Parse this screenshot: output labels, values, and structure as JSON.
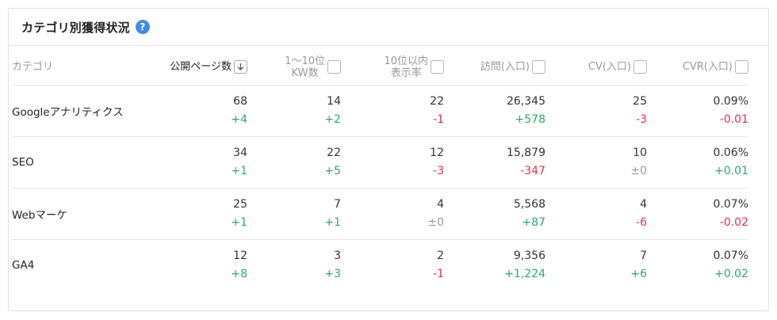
{
  "title": "カテゴリ別獲得状況",
  "help_glyph": "?",
  "colors": {
    "positive": "#2daa6a",
    "negative": "#e0334a",
    "neutral": "#999999",
    "accent": "#3d8de6"
  },
  "columns": [
    {
      "key": "category",
      "label": "カテゴリ"
    },
    {
      "key": "public_pages",
      "label": "公開ページ数",
      "control": "sort-desc"
    },
    {
      "key": "kw_1_10",
      "label": "1〜10位\nKW数",
      "control": "checkbox"
    },
    {
      "key": "kw_10_within_rate",
      "label": "10位以内\n表示率",
      "control": "checkbox"
    },
    {
      "key": "visits",
      "label": "訪問(入口)",
      "control": "checkbox"
    },
    {
      "key": "cv",
      "label": "CV(入口)",
      "control": "checkbox"
    },
    {
      "key": "cvr",
      "label": "CVR(入口)",
      "control": "checkbox"
    }
  ],
  "rows": [
    {
      "category": "Googleアナリティクス",
      "cells": [
        {
          "value": "68",
          "delta": "+4",
          "trend": "pos"
        },
        {
          "value": "14",
          "delta": "+2",
          "trend": "pos"
        },
        {
          "value": "22",
          "delta": "-1",
          "trend": "neg"
        },
        {
          "value": "26,345",
          "delta": "+578",
          "trend": "pos"
        },
        {
          "value": "25",
          "delta": "-3",
          "trend": "neg"
        },
        {
          "value": "0.09%",
          "delta": "-0.01",
          "trend": "neg"
        }
      ]
    },
    {
      "category": "SEO",
      "cells": [
        {
          "value": "34",
          "delta": "+1",
          "trend": "pos"
        },
        {
          "value": "22",
          "delta": "+5",
          "trend": "pos"
        },
        {
          "value": "12",
          "delta": "-3",
          "trend": "neg"
        },
        {
          "value": "15,879",
          "delta": "-347",
          "trend": "neg"
        },
        {
          "value": "10",
          "delta": "±0",
          "trend": "zero"
        },
        {
          "value": "0.06%",
          "delta": "+0.01",
          "trend": "pos"
        }
      ]
    },
    {
      "category": "Webマーケ",
      "cells": [
        {
          "value": "25",
          "delta": "+1",
          "trend": "pos"
        },
        {
          "value": "7",
          "delta": "+1",
          "trend": "pos"
        },
        {
          "value": "4",
          "delta": "±0",
          "trend": "zero"
        },
        {
          "value": "5,568",
          "delta": "+87",
          "trend": "pos"
        },
        {
          "value": "4",
          "delta": "-6",
          "trend": "neg"
        },
        {
          "value": "0.07%",
          "delta": "-0.02",
          "trend": "neg"
        }
      ]
    },
    {
      "category": "GA4",
      "cells": [
        {
          "value": "12",
          "delta": "+8",
          "trend": "pos"
        },
        {
          "value": "3",
          "delta": "+3",
          "trend": "pos"
        },
        {
          "value": "2",
          "delta": "-1",
          "trend": "neg"
        },
        {
          "value": "9,356",
          "delta": "+1,224",
          "trend": "pos"
        },
        {
          "value": "7",
          "delta": "+6",
          "trend": "pos"
        },
        {
          "value": "0.07%",
          "delta": "+0.02",
          "trend": "pos"
        }
      ]
    }
  ]
}
